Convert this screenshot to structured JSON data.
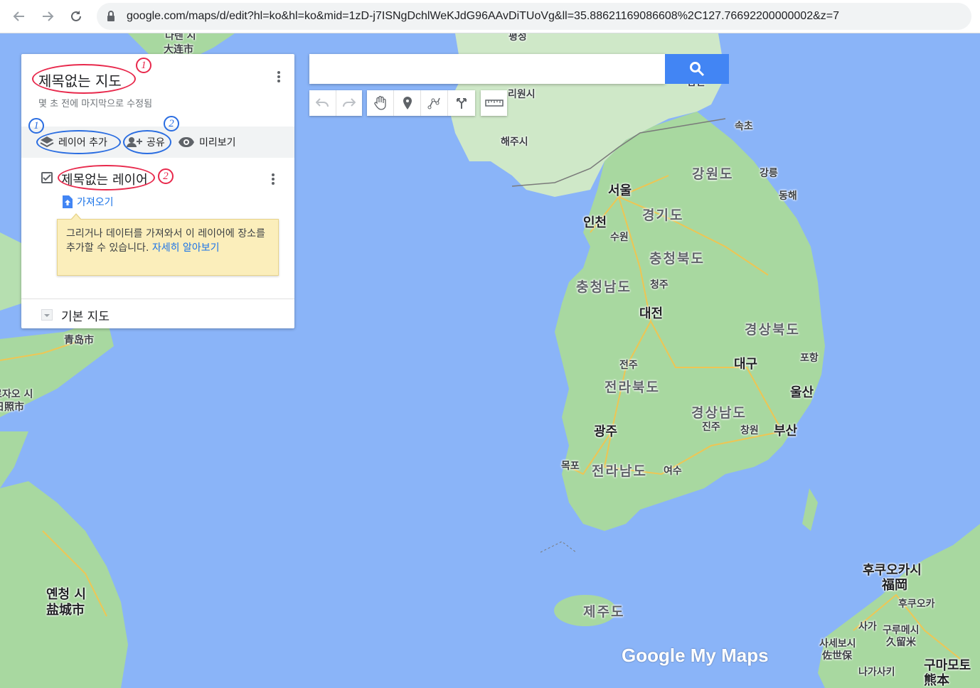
{
  "browser": {
    "url": "google.com/maps/d/edit?hl=ko&hl=ko&mid=1zD-j7ISNgDchlWeKJdG96AAvDiTUoVg&ll=35.88621169086608%2C127.76692200000002&z=7"
  },
  "panel": {
    "title": "제목없는 지도",
    "status": "몇 초 전에 마지막으로 수정됨",
    "toolbar": {
      "add_layer": "레이어 추가",
      "share": "공유",
      "preview": "미리보기"
    },
    "layer": {
      "name": "제목없는 레이어",
      "checked": true,
      "import": "가져오기"
    },
    "tooltip": {
      "text": "그리거나 데이터를 가져와서 이 레이어에 장소를 추가할 수 있습니다.",
      "link": "자세히 알아보기"
    },
    "basemap": "기본 지도"
  },
  "annotations": {
    "title_num": "1",
    "add_layer_num": "1",
    "share_num": "2",
    "layer_num": "2"
  },
  "search": {
    "placeholder": ""
  },
  "map_labels": {
    "seoul": "서울",
    "incheon": "인천",
    "suwon": "수원",
    "gyeonggi": "경기도",
    "gangwon": "강원도",
    "gangneung": "강릉",
    "donghae": "동해",
    "sokcho": "속초",
    "chungbuk": "충청북도",
    "chungnam": "충청남도",
    "cheongju": "청주",
    "daejeon": "대전",
    "gyeongbuk": "경상북도",
    "pohang": "포항",
    "daegu": "대구",
    "ulsan": "울산",
    "jeonju": "전주",
    "jeonbuk": "전라북도",
    "gyeongnam": "경상남도",
    "jinju": "진주",
    "changwon": "창원",
    "busan": "부산",
    "gwangju": "광주",
    "mokpo": "목포",
    "jeonnam": "전라남도",
    "yeosu": "여수",
    "jeju": "제주도",
    "haeju": "해주시",
    "pyongsong": "평성",
    "pyongsong2": "남한",
    "sariwon": "리원시",
    "dalian_ko": "다렌 시",
    "dalian": "大连市",
    "qingdao": "青岛市",
    "rizhao_ko": "르자오 시",
    "rizhao": "日照市",
    "yancheng_ko": "옌청 시",
    "yancheng": "盐城市",
    "fukuoka_ko": "후쿠오카시",
    "fukuoka": "福岡",
    "fukuoka2": "후쿠오카",
    "kurume_ko": "구루메시",
    "kurume": "久留米",
    "sasebo_ko": "사세보시",
    "sasebo": "佐世保",
    "kumamoto_ko": "구마모토",
    "kumamoto": "熊本",
    "saga": "사가",
    "nagasaki": "나가사키"
  },
  "logo": "Google My Maps"
}
